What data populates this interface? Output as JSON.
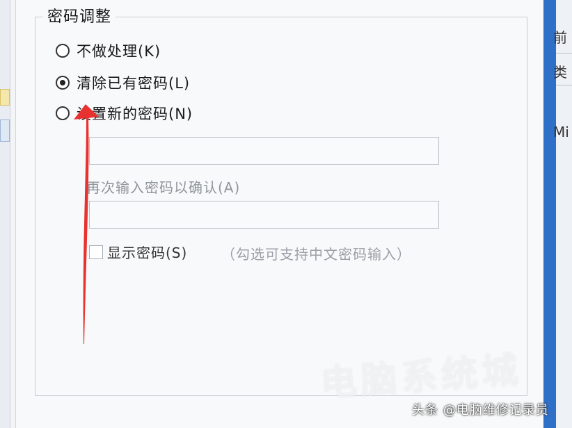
{
  "group": {
    "title": "密码调整",
    "options": [
      {
        "label": "不做处理(K)",
        "checked": false
      },
      {
        "label": "清除已有密码(L)",
        "checked": true
      },
      {
        "label": "设置新的密码(N)",
        "checked": false
      }
    ],
    "confirm_label": "再次输入密码以确认(A)",
    "show_password_label": "显示密码(S)",
    "show_password_hint": "（勾选可支持中文密码输入）"
  },
  "background_fragments": {
    "left": [
      " ",
      " "
    ],
    "right": [
      "前",
      "类",
      "Mi"
    ]
  },
  "watermark": {
    "text": "电脑系统城"
  },
  "credit": "头条 @电脑维修记录员",
  "annotation": {
    "color": "#e8322f"
  }
}
